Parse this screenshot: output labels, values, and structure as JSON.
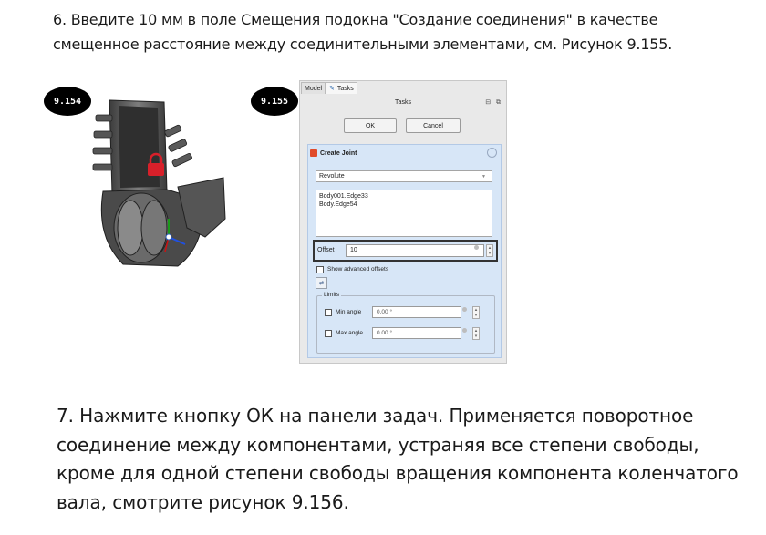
{
  "step6_text": "6. Введите 10 мм в поле Смещения подокна \"Создание соединения\" в качестве смещенное расстояние между соединительными элементами, см. Рисунок 9.155.",
  "step7_text": "7. Нажмите кнопку ОК на панели задач. Применяется поворотное соединение между компонентами, устраняя все степени свободы, кроме для одной степени свободы вращения компонента коленчатого вала, смотрите рисунок 9.156.",
  "figure_badges": {
    "fig154": "9.154",
    "fig155": "9.155"
  },
  "tasks_panel": {
    "tabs": {
      "model": "Model",
      "tasks": "Tasks"
    },
    "title": "Tasks",
    "window_buttons": "⊟ ⧉",
    "ok_label": "OK",
    "cancel_label": "Cancel",
    "create_joint_title": "Create Joint",
    "joint_type": "Revolute",
    "references": [
      "Body001.Edge33",
      "Body.Edge54"
    ],
    "offset_label": "Offset",
    "offset_value": "10",
    "show_advanced_label": "Show advanced offsets",
    "limits_legend": "Limits",
    "min_angle_label": "Min angle",
    "min_angle_value": "0.00 °",
    "max_angle_label": "Max angle",
    "max_angle_value": "0.00 °"
  },
  "colors": {
    "panel_blue": "#d7e6f7",
    "freecad_red": "#e04a2a",
    "part_grey": "#4d4d4d",
    "lock_red": "#d8202a"
  },
  "icons": [
    "freecad-joint-icon",
    "pencil-icon",
    "collapse-icon",
    "caret-down-icon",
    "swap-icon",
    "lock-icon"
  ]
}
